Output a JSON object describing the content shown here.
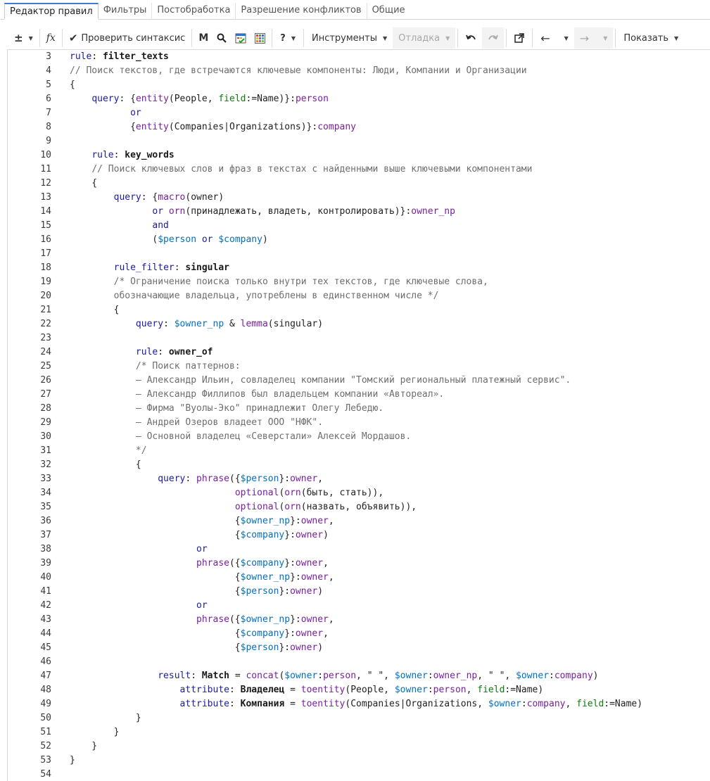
{
  "tabs": [
    {
      "label": "Редактор правил",
      "active": true
    },
    {
      "label": "Фильтры"
    },
    {
      "label": "Постобработка"
    },
    {
      "label": "Разрешение конфликтов"
    },
    {
      "label": "Общие"
    }
  ],
  "toolbar": {
    "plusminus": "±",
    "fx": "fx",
    "check_syntax": "Проверить синтаксис",
    "m": "M",
    "help": "?",
    "tools": "Инструменты",
    "debug": "Отладка",
    "show": "Показать"
  },
  "editor": {
    "lines": [
      {
        "n": "3",
        "html": "<span class=\"kw\">rule</span>: <span class=\"b\">filter_texts</span>"
      },
      {
        "n": "4",
        "html": "<span class=\"c\">// Поиск текстов, где встречаются ключевые компоненты: Люди, Компании и Организации</span>"
      },
      {
        "n": "5",
        "html": "{"
      },
      {
        "n": "6",
        "html": "    <span class=\"kw\">query</span>: {<span class=\"p\">entity</span>(People, <span class=\"s\">field</span>:=Name)}:<span class=\"p\">person</span>"
      },
      {
        "n": "7",
        "html": "           <span class=\"kw\">or</span>"
      },
      {
        "n": "8",
        "html": "           {<span class=\"p\">entity</span>(Companies|Organizations)}:<span class=\"p\">company</span>"
      },
      {
        "n": "9",
        "html": ""
      },
      {
        "n": "10",
        "html": "    <span class=\"kw\">rule</span>: <span class=\"b\">key_words</span>"
      },
      {
        "n": "11",
        "html": "    <span class=\"c\">// Поиск ключевых слов и фраз в текстах с найденными выше ключевыми компонентами</span>"
      },
      {
        "n": "12",
        "html": "    {"
      },
      {
        "n": "13",
        "html": "        <span class=\"kw\">query</span>: {<span class=\"p\">macro</span>(owner)"
      },
      {
        "n": "14",
        "html": "               <span class=\"kw\">or</span> <span class=\"p\">orn</span>(принадлежать, владеть, контролировать)}:<span class=\"p\">owner_np</span>"
      },
      {
        "n": "15",
        "html": "               <span class=\"kw\">and</span>"
      },
      {
        "n": "16",
        "html": "               (<span class=\"v\">$person</span> <span class=\"kw\">or</span> <span class=\"v\">$company</span>)"
      },
      {
        "n": "17",
        "html": ""
      },
      {
        "n": "18",
        "html": "        <span class=\"kw\">rule_filter</span>: <span class=\"b\">singular</span>"
      },
      {
        "n": "19",
        "html": "        <span class=\"c\">/* Ограничение поиска только внутри тех текстов, где ключевые слова,</span>"
      },
      {
        "n": "20",
        "html": "        <span class=\"c\">обозначающие владельца, употреблены в единственном числе */</span>"
      },
      {
        "n": "21",
        "html": "        {"
      },
      {
        "n": "22",
        "html": "            <span class=\"kw\">query</span>: <span class=\"v\">$owner_np</span> &amp; <span class=\"p\">lemma</span>(singular)"
      },
      {
        "n": "23",
        "html": ""
      },
      {
        "n": "24",
        "html": "            <span class=\"kw\">rule</span>: <span class=\"b\">owner_of</span>"
      },
      {
        "n": "25",
        "html": "            <span class=\"c\">/* Поиск паттернов:</span>"
      },
      {
        "n": "26",
        "html": "            <span class=\"c\">– Александр Ильин, совладелец компании \"Томский региональный платежный сервис\".</span>"
      },
      {
        "n": "27",
        "html": "            <span class=\"c\">– Александр Филлипов был владельцем компании «Автореал».</span>"
      },
      {
        "n": "28",
        "html": "            <span class=\"c\">– Фирма \"Вуолы-Эко\" принадлежит Олегу Лебедю.</span>"
      },
      {
        "n": "29",
        "html": "            <span class=\"c\">– Андрей Озеров владеет ООО \"НФК\".</span>"
      },
      {
        "n": "30",
        "html": "            <span class=\"c\">– Основной владелец «Северстали» Алексей Мордашов.</span>"
      },
      {
        "n": "31",
        "html": "            <span class=\"c\">*/</span>"
      },
      {
        "n": "32",
        "html": "            {"
      },
      {
        "n": "33",
        "html": "                <span class=\"kw\">query</span>: <span class=\"p\">phrase</span>({<span class=\"v\">$person</span>}:<span class=\"p\">owner</span>,"
      },
      {
        "n": "34",
        "html": "                              <span class=\"p\">optional</span>(<span class=\"p\">orn</span>(быть, стать)),"
      },
      {
        "n": "35",
        "html": "                              <span class=\"p\">optional</span>(<span class=\"p\">orn</span>(назвать, объявить)),"
      },
      {
        "n": "36",
        "html": "                              {<span class=\"v\">$owner_np</span>}:<span class=\"p\">owner</span>,"
      },
      {
        "n": "37",
        "html": "                              {<span class=\"v\">$company</span>}:<span class=\"p\">owner</span>)"
      },
      {
        "n": "38",
        "html": "                       <span class=\"kw\">or</span>"
      },
      {
        "n": "39",
        "html": "                       <span class=\"p\">phrase</span>({<span class=\"v\">$company</span>}:<span class=\"p\">owner</span>,"
      },
      {
        "n": "40",
        "html": "                              {<span class=\"v\">$owner_np</span>}:<span class=\"p\">owner</span>,"
      },
      {
        "n": "41",
        "html": "                              {<span class=\"v\">$person</span>}:<span class=\"p\">owner</span>)"
      },
      {
        "n": "42",
        "html": "                       <span class=\"kw\">or</span>"
      },
      {
        "n": "43",
        "html": "                       <span class=\"p\">phrase</span>({<span class=\"v\">$owner_np</span>}:<span class=\"p\">owner</span>,"
      },
      {
        "n": "44",
        "html": "                              {<span class=\"v\">$company</span>}:<span class=\"p\">owner</span>,"
      },
      {
        "n": "45",
        "html": "                              {<span class=\"v\">$person</span>}:<span class=\"p\">owner</span>)"
      },
      {
        "n": "46",
        "html": ""
      },
      {
        "n": "47",
        "html": "                <span class=\"kw\">result</span>: <span class=\"b\">Match</span> = <span class=\"p\">concat</span>(<span class=\"v\">$owner</span>:<span class=\"p\">person</span>, \" \", <span class=\"v\">$owner</span>:<span class=\"p\">owner_np</span>, \" \", <span class=\"v\">$owner</span>:<span class=\"p\">company</span>)"
      },
      {
        "n": "48",
        "html": "                    <span class=\"kw\">attribute</span>: <span class=\"b\">Владелец</span> = <span class=\"p\">toentity</span>(People, <span class=\"v\">$owner</span>:<span class=\"p\">person</span>, <span class=\"s\">field</span>:=Name)"
      },
      {
        "n": "49",
        "html": "                    <span class=\"kw\">attribute</span>: <span class=\"b\">Компания</span> = <span class=\"p\">toentity</span>(Companies|Organizations, <span class=\"v\">$owner</span>:<span class=\"p\">company</span>, <span class=\"s\">field</span>:=Name)"
      },
      {
        "n": "50",
        "html": "            }"
      },
      {
        "n": "51",
        "html": "        }"
      },
      {
        "n": "52",
        "html": "    }"
      },
      {
        "n": "53",
        "html": "}"
      },
      {
        "n": "54",
        "html": ""
      }
    ]
  }
}
